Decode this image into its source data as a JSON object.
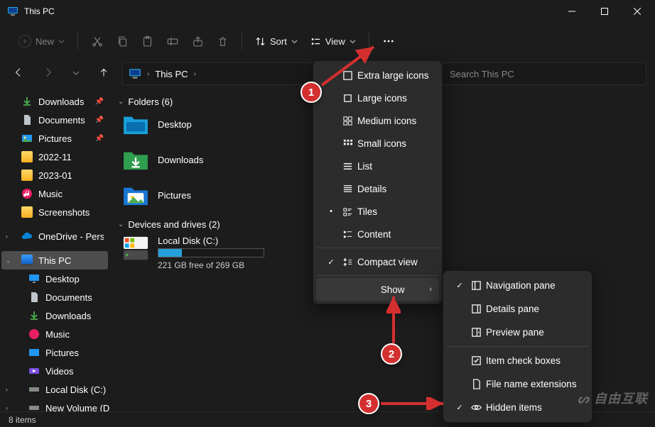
{
  "window": {
    "title": "This PC"
  },
  "toolbar": {
    "new": "New",
    "sort": "Sort",
    "view": "View"
  },
  "breadcrumb": {
    "location": "This PC"
  },
  "search": {
    "placeholder": "Search This PC"
  },
  "sidebar": {
    "quick": [
      {
        "label": "Downloads",
        "pinned": true
      },
      {
        "label": "Documents",
        "pinned": true
      },
      {
        "label": "Pictures",
        "pinned": true
      },
      {
        "label": "2022-11",
        "pinned": false
      },
      {
        "label": "2023-01",
        "pinned": false
      },
      {
        "label": "Music",
        "pinned": false
      },
      {
        "label": "Screenshots",
        "pinned": false
      }
    ],
    "onedrive": "OneDrive - Personal",
    "thispc": "This PC",
    "pcitems": [
      {
        "label": "Desktop"
      },
      {
        "label": "Documents"
      },
      {
        "label": "Downloads"
      },
      {
        "label": "Music"
      },
      {
        "label": "Pictures"
      },
      {
        "label": "Videos"
      },
      {
        "label": "Local Disk (C:)"
      },
      {
        "label": "New Volume (D:)"
      }
    ]
  },
  "content": {
    "folders_header": "Folders (6)",
    "folders": [
      {
        "label": "Desktop"
      },
      {
        "label": "Downloads"
      },
      {
        "label": "Pictures"
      }
    ],
    "drives_header": "Devices and drives (2)",
    "drive": {
      "label": "Local Disk (C:)",
      "free": "221 GB free of 269 GB"
    }
  },
  "viewmenu": {
    "items": [
      "Extra large icons",
      "Large icons",
      "Medium icons",
      "Small icons",
      "List",
      "Details",
      "Tiles",
      "Content"
    ],
    "compact": "Compact view",
    "show": "Show"
  },
  "showmenu": {
    "items": [
      "Navigation pane",
      "Details pane",
      "Preview pane",
      "Item check boxes",
      "File name extensions",
      "Hidden items"
    ]
  },
  "status": {
    "text": "8 items"
  },
  "annotations": {
    "m1": "1",
    "m2": "2",
    "m3": "3"
  },
  "watermark": "自由互联"
}
